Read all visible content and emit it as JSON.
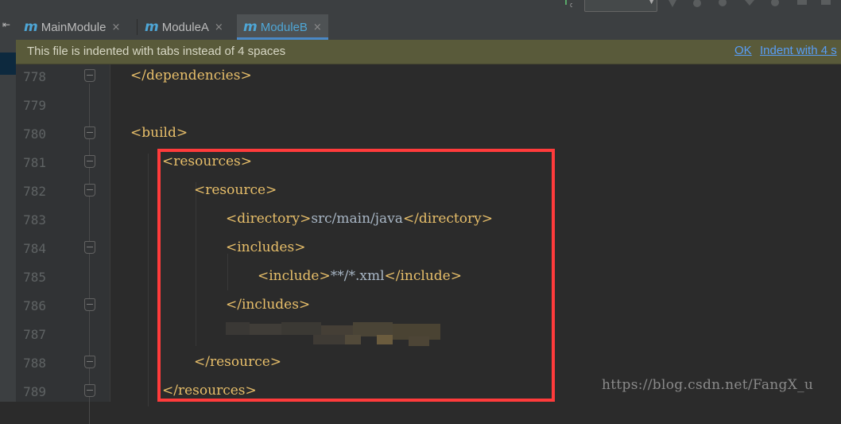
{
  "tabs": [
    {
      "label": "MainModule",
      "icon": "maven-module-icon",
      "active": false
    },
    {
      "label": "ModuleA",
      "icon": "maven-module-icon",
      "active": false
    },
    {
      "label": "ModuleB",
      "icon": "maven-module-icon",
      "active": true
    }
  ],
  "module_glyph": "m",
  "close_glyph": "×",
  "notification": {
    "message": "This file is indented with tabs instead of 4 spaces",
    "ok_label": "OK",
    "indent_label": "Indent with 4 s"
  },
  "lines": [
    {
      "num": "778",
      "tag_open": "</dependencies>",
      "text": "",
      "tag_close": ""
    },
    {
      "num": "779",
      "tag_open": "",
      "text": "",
      "tag_close": ""
    },
    {
      "num": "780",
      "tag_open": "<build>",
      "text": "",
      "tag_close": ""
    },
    {
      "num": "781",
      "tag_open": "<resources>",
      "text": "",
      "tag_close": ""
    },
    {
      "num": "782",
      "tag_open": "<resource>",
      "text": "",
      "tag_close": ""
    },
    {
      "num": "783",
      "tag_open": "<directory>",
      "text": "src/main/java",
      "tag_close": "</directory>"
    },
    {
      "num": "784",
      "tag_open": "<includes>",
      "text": "",
      "tag_close": ""
    },
    {
      "num": "785",
      "tag_open": "<include>",
      "text": "**/*.xml",
      "tag_close": "</include>"
    },
    {
      "num": "786",
      "tag_open": "</includes>",
      "text": "",
      "tag_close": ""
    },
    {
      "num": "787",
      "tag_open": "",
      "text": "",
      "tag_close": ""
    },
    {
      "num": "788",
      "tag_open": "</resource>",
      "text": "",
      "tag_close": ""
    },
    {
      "num": "789",
      "tag_open": "</resources>",
      "text": "",
      "tag_close": ""
    }
  ],
  "watermark": "https://blog.csdn.net/FangX_u",
  "colors": {
    "tag": "#e8bf6a",
    "text": "#a9b7c6",
    "highlight": "#ff3b3b",
    "active_tab_text": "#4ea6d6"
  }
}
